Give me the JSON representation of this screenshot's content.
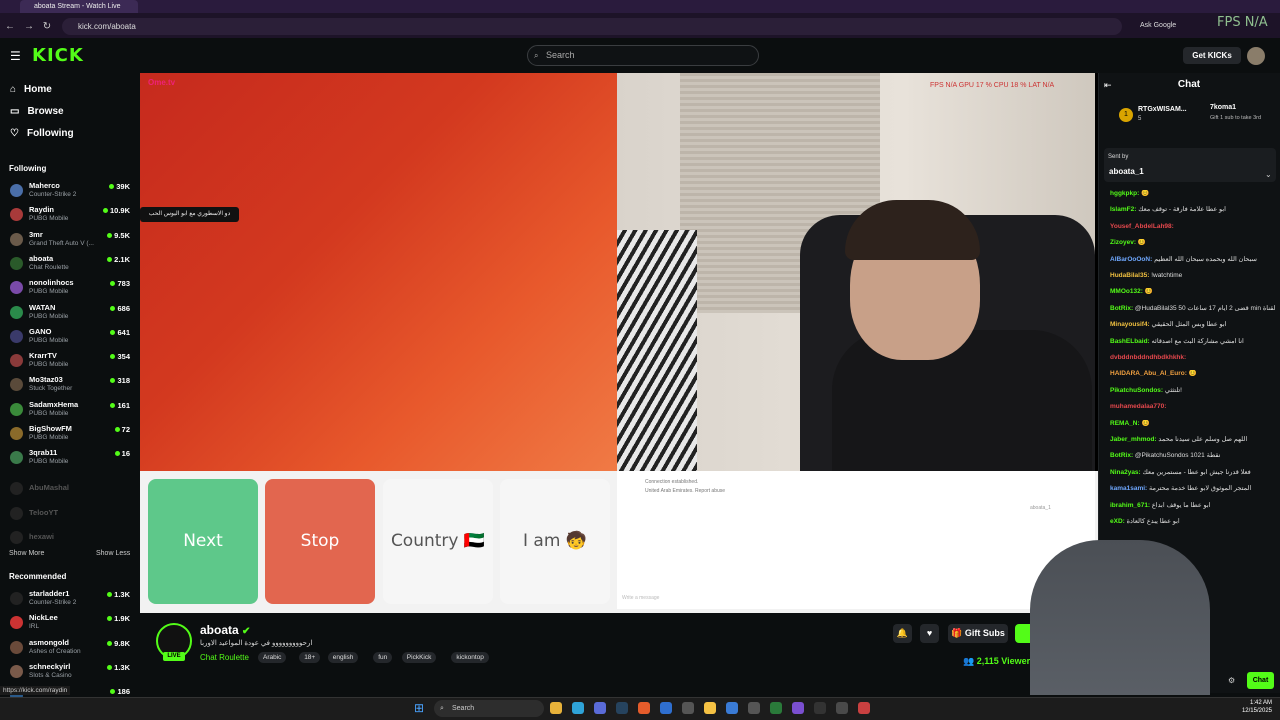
{
  "browser": {
    "tab_title": "aboata Stream - Watch Live",
    "url": "kick.com/aboata",
    "ask_google": "Ask Google",
    "fps_overlay": "FPS N/A"
  },
  "header": {
    "logo": "KICK",
    "search_placeholder": "Search",
    "get_kicks": "Get KICKs"
  },
  "sidebar": {
    "nav": [
      "Home",
      "Browse",
      "Following"
    ],
    "following_title": "Following",
    "following": [
      {
        "name": "Maherco",
        "sub": "Counter-Strike 2",
        "count": "39K"
      },
      {
        "name": "Raydin",
        "sub": "PUBG Mobile",
        "count": "10.9K"
      },
      {
        "name": "3mr",
        "sub": "Grand Theft Auto V (...",
        "count": "9.5K"
      },
      {
        "name": "aboata",
        "sub": "Chat Roulette",
        "count": "2.1K"
      },
      {
        "name": "nonolinhocs",
        "sub": "PUBG Mobile",
        "count": "783"
      },
      {
        "name": "WATAN",
        "sub": "PUBG Mobile",
        "count": "686"
      },
      {
        "name": "GANO",
        "sub": "PUBG Mobile",
        "count": "641"
      },
      {
        "name": "KrarrTV",
        "sub": "PUBG Mobile",
        "count": "354"
      },
      {
        "name": "Mo3taz03",
        "sub": "Stuck Together",
        "count": "318"
      },
      {
        "name": "SadamxHema",
        "sub": "PUBG Mobile",
        "count": "161"
      },
      {
        "name": "BigShowFM",
        "sub": "PUBG Mobile",
        "count": "72"
      },
      {
        "name": "3qrab11",
        "sub": "PUBG Mobile",
        "count": "16"
      }
    ],
    "offline": [
      "AbuMashal",
      "TelooYT",
      "hexawi"
    ],
    "show_more": "Show More",
    "show_less": "Show Less",
    "recommended_title": "Recommended",
    "recommended": [
      {
        "name": "starladder1",
        "sub": "Counter-Strike 2",
        "count": "1.3K"
      },
      {
        "name": "NickLee",
        "sub": "IRL",
        "count": "1.9K"
      },
      {
        "name": "asmongold",
        "sub": "Ashes of Creation",
        "count": "9.8K"
      },
      {
        "name": "schneckyirl",
        "sub": "Slots & Casino",
        "count": "1.3K"
      },
      {
        "name": "",
        "sub": "",
        "count": "186"
      }
    ],
    "tooltip": "دو الاسطوري مع ابو اليوس الحب"
  },
  "video": {
    "ometv": "Ome.tv",
    "stats": "FPS N/A   GPU 17 %   CPU 18 %   LAT N/A",
    "buttons": {
      "next": "Next",
      "stop": "Stop",
      "country": "Country 🇦🇪",
      "iam": "I am 🧒"
    },
    "conn1": "Connection established.",
    "conn2": "United Arab Emirates. Report abuse",
    "msg_placeholder": "Write a message",
    "username": "aboata_1"
  },
  "stream": {
    "name": "aboata",
    "title": "ارحووووووووو في عودة المواعيد الاوربا",
    "category": "Chat Roulette",
    "tags": [
      "Arabic",
      "18+",
      "english",
      "fun",
      "PickKick",
      "kickontop"
    ],
    "gift_subs": "Gift Subs",
    "viewers": "2,115 Viewers",
    "live": "LIVE"
  },
  "chat": {
    "title": "Chat",
    "top_gifter": "RTGxWISAM...",
    "top_gifter_count": "5",
    "second": "7koma1",
    "second_note": "Gift 1 sub to take 3rd",
    "pinned_label": "Sent by",
    "pinned_user": "aboata_1",
    "messages": [
      {
        "user": "hggkpkp:",
        "text": "😊"
      },
      {
        "user": "IslamF2:",
        "text": "ابو عطا علامة فارقة - توقف معك"
      },
      {
        "user": "Yousef_AbdelLah98:",
        "text": ""
      },
      {
        "user": "Zizoyev:",
        "text": "😊"
      },
      {
        "user": "AlBarOoOoN:",
        "text": "سبحان الله وبحمده سبحان الله العظيم"
      },
      {
        "user": "HudaBilal35:",
        "text": "!watchtime"
      },
      {
        "user": "MMOo132:",
        "text": "😊"
      },
      {
        "user": "BotRix:",
        "text": "@HudaBilal35 قضى 2 أيام 17 ساعات 50 min مشاهدة هذه القناة"
      },
      {
        "user": "Minayousif4:",
        "text": "ابو عطا وبس المثل الحقيقي"
      },
      {
        "user": "BashELbaid:",
        "text": "انا امشي مشاركة البث مع اصدقائه"
      },
      {
        "user": "dvbddnbddndhbdkhkhk:",
        "text": ""
      },
      {
        "user": "HAIDARA_Abu_Al_Euro:",
        "text": "😊"
      },
      {
        "user": "PikatchuSondos:",
        "text": "تلتثثي!"
      },
      {
        "user": "muhamedalaa770:",
        "text": ""
      },
      {
        "user": "REMA_N:",
        "text": "😊"
      },
      {
        "user": "Jaber_mhmod:",
        "text": "اللهم صل وسلم على سيدنا محمد"
      },
      {
        "user": "BotRix:",
        "text": "@PikatchuSondos 1021 نقطة"
      },
      {
        "user": "Nina2yas:",
        "text": "فعلا قدرنا جيش ابو عطا - مستمرين معك"
      },
      {
        "user": "kama1sami:",
        "text": "المتجر الموثوق لابو عطا خدمة محترمة"
      },
      {
        "user": "ibrahim_671:",
        "text": "ابو عطا ما يوقف ابداع"
      },
      {
        "user": "eXD:",
        "text": "ابو عطا يبدع كالعادة"
      }
    ],
    "send": "Chat"
  },
  "taskbar": {
    "search": "Search",
    "time": "1:42 AM",
    "date": "12/15/2025"
  },
  "status_url": "https://kick.com/raydin"
}
